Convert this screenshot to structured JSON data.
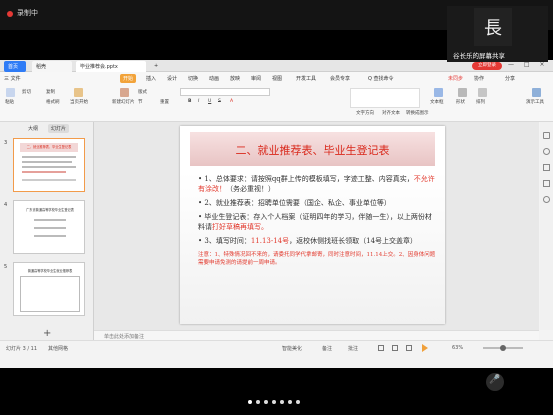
{
  "recording": {
    "label": "录制中"
  },
  "webcam": {
    "glyph": "長",
    "name": "谷长乐的屏幕共享"
  },
  "app": {
    "tabs": [
      "首页",
      "稻壳",
      "毕业推荐会.pptx"
    ],
    "new_tab": "+",
    "user_badge": "立即登录",
    "window_controls": "— □ ×",
    "menu": [
      "三 文件",
      "开始",
      "插入",
      "设计",
      "切换",
      "动画",
      "放映",
      "审阅",
      "视图",
      "开发工具",
      "会员专享",
      "Q 查找命令",
      "未同步",
      "协作",
      "分享"
    ],
    "ribbon": {
      "row1": [
        "粘贴",
        "剪切",
        "复制",
        "格式刷",
        "当页开始",
        "新建幻灯片",
        "版式",
        "节",
        "重置",
        "B",
        "I",
        "U",
        "S",
        "A",
        "文本框",
        "形状",
        "排列",
        "演示工具"
      ],
      "row2": [
        "文字方向",
        "对齐文本",
        "转换成图示"
      ]
    },
    "panel_tabs": [
      "大纲",
      "幻灯片"
    ],
    "thumbnails": [
      {
        "num": "3",
        "title": "二、就业推荐表、毕业生登记表",
        "selected": true
      },
      {
        "num": "4",
        "title": "广东省普通高等学校毕业生登记表",
        "selected": false
      },
      {
        "num": "5",
        "title": "普通高等学校毕业生就业推荐表",
        "selected": false
      }
    ],
    "add_slide": "+",
    "notes_placeholder": "单击此处添加备注",
    "status": {
      "slide_info": "幻灯片 3 / 11",
      "theme": "其他网格",
      "beautify": "智能美化",
      "notes": "备注",
      "comment": "批注",
      "zoom": "63%"
    }
  },
  "slide": {
    "title": "二、就业推荐表、毕业生登记表",
    "items": [
      {
        "num": "1、",
        "text": "总体要求：请按照qq群上传的模板填写，字迹工整、内容真实，",
        "emphasis": "不允许有涂改！",
        "tail": "（务必重视！）"
      },
      {
        "num": "2、",
        "text": "就业推荐表：招聘单位需要（国企、私企、事业单位等）",
        "emphasis": "",
        "tail": ""
      },
      {
        "num": "",
        "text": "毕业生登记表：存入个人档案（证明四年的学习，伴随一生），以上两份材料请",
        "emphasis": "打好草稿再填写。",
        "tail": ""
      },
      {
        "num": "3、",
        "text": "填写时间：",
        "emphasis": "11.13-14号",
        "tail": "，返校休侧找班长领取（14号上交盖章）"
      }
    ],
    "note_label": "注意：",
    "note_text": "1、特殊情况回不来的，请委托同学代拿邮寄，同时注意时间，11.14上交。2、因身体问题需要申请免测的请提前一周申请。"
  },
  "mic_glyph": "🎤",
  "page_dots": 7
}
